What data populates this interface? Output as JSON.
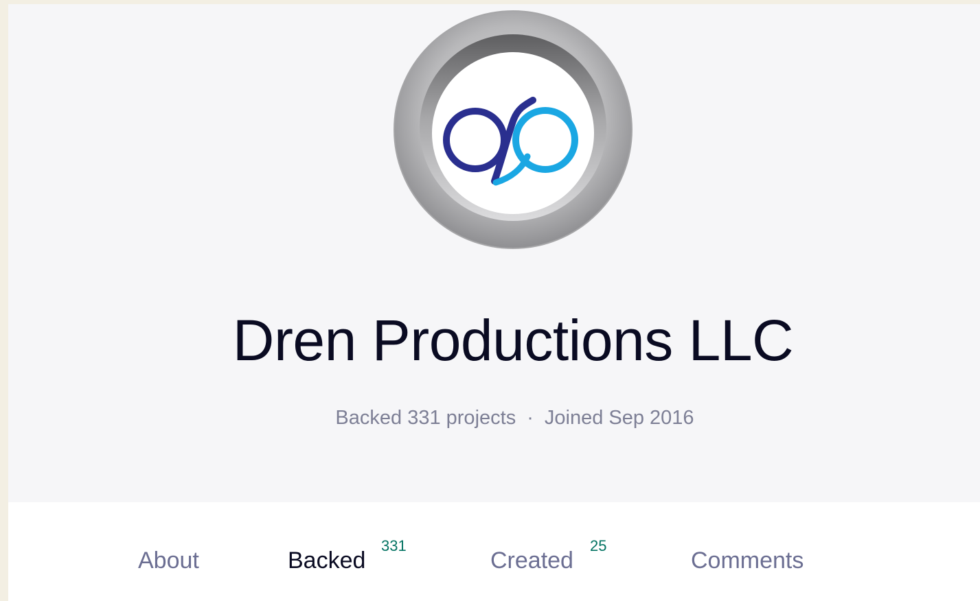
{
  "profile": {
    "name": "Dren Productions LLC",
    "backed_text": "Backed 331 projects",
    "separator": "·",
    "joined_text": "Joined Sep 2016",
    "avatar_icon": "dren-productions-logo-icon"
  },
  "tabs": [
    {
      "label": "About",
      "count": "",
      "active": false
    },
    {
      "label": "Backed",
      "count": "331",
      "active": true
    },
    {
      "label": "Created",
      "count": "25",
      "active": false
    },
    {
      "label": "Comments",
      "count": "",
      "active": false
    }
  ],
  "colors": {
    "page_background": "#f6f6f8",
    "outer_background": "#f3efe3",
    "name_text": "#0a0b22",
    "meta_text": "#7d7f95",
    "tab_text": "#6b6e92",
    "tab_active_text": "#0a0b22",
    "count_text": "#037362",
    "logo_dark_blue": "#2a2f8f",
    "logo_light_blue": "#1aa7e3"
  }
}
